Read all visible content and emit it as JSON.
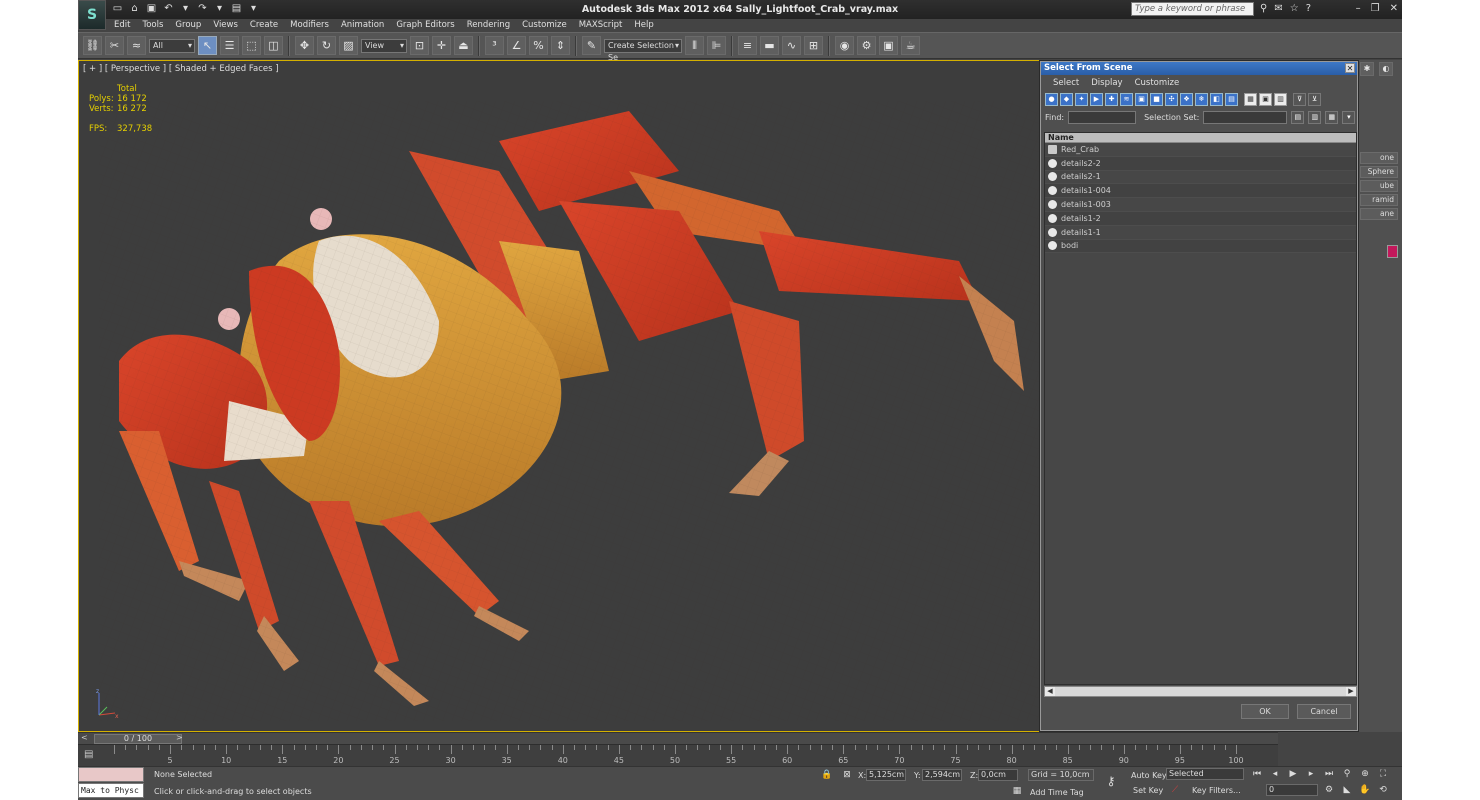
{
  "app": {
    "logo": "S",
    "title": "Autodesk 3ds Max  2012 x64     Sally_Lightfoot_Crab_vray.max",
    "search_placeholder": "Type a keyword or phrase"
  },
  "menu": [
    "Edit",
    "Tools",
    "Group",
    "Views",
    "Create",
    "Modifiers",
    "Animation",
    "Graph Editors",
    "Rendering",
    "Customize",
    "MAXScript",
    "Help"
  ],
  "toolbar": {
    "filter_select": "All",
    "coord_select": "View",
    "selection_set": "Create Selection Se"
  },
  "viewport": {
    "label": "[ + ] [ Perspective ] [ Shaded + Edged Faces ]",
    "stats": {
      "total_label": "Total",
      "polys_label": "Polys:",
      "polys_value": "16 172",
      "verts_label": "Verts:",
      "verts_value": "16 272",
      "fps_label": "FPS:",
      "fps_value": "327,738"
    }
  },
  "command_panel": {
    "buttons": [
      "one",
      "Sphere",
      "ube",
      "ramid",
      "ane"
    ],
    "color": "#c2185b"
  },
  "dialog": {
    "title": "Select From Scene",
    "menu": [
      "Select",
      "Display",
      "Customize"
    ],
    "find_label": "Find:",
    "selset_label": "Selection Set:",
    "column_name": "Name",
    "objects": [
      {
        "name": "Red_Crab",
        "type": "group"
      },
      {
        "name": "details2-2",
        "type": "mesh"
      },
      {
        "name": "details2-1",
        "type": "mesh"
      },
      {
        "name": "details1-004",
        "type": "mesh"
      },
      {
        "name": "details1-003",
        "type": "mesh"
      },
      {
        "name": "details1-2",
        "type": "mesh"
      },
      {
        "name": "details1-1",
        "type": "mesh"
      },
      {
        "name": "bodi",
        "type": "mesh"
      }
    ],
    "ok_label": "OK",
    "cancel_label": "Cancel"
  },
  "timeline": {
    "frame_display": "0 / 100",
    "ticks": [
      0,
      5,
      10,
      15,
      20,
      25,
      30,
      35,
      40,
      45,
      50,
      55,
      60,
      65,
      70,
      75,
      80,
      85,
      90,
      95,
      100
    ],
    "end": 100
  },
  "status": {
    "maxscript_label": "Max to Physc",
    "selected_text": "None Selected",
    "prompt_text": "Click or click-and-drag to select objects",
    "x_label": "X:",
    "x_value": "5,125cm",
    "y_label": "Y:",
    "y_value": "2,594cm",
    "z_label": "Z:",
    "z_value": "0,0cm",
    "grid_label": "Grid = 10,0cm",
    "add_time_tag": "Add Time Tag",
    "auto_key": "Auto Key",
    "set_key": "Set Key",
    "selected_option": "Selected",
    "key_filters": "Key Filters...",
    "frame_value": "0"
  }
}
